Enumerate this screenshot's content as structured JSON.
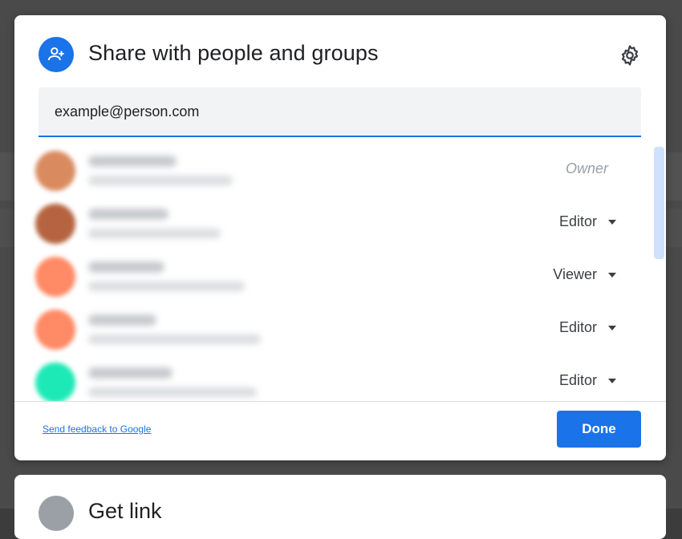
{
  "dialog": {
    "title": "Share with people and groups",
    "input": {
      "value": "example@person.com",
      "placeholder": ""
    },
    "people": [
      {
        "role": "Owner",
        "avatar_color": "#d98b5f",
        "owner": true
      },
      {
        "role": "Editor",
        "avatar_color": "#b5643f",
        "owner": false
      },
      {
        "role": "Viewer",
        "avatar_color": "#ff8a65",
        "owner": false
      },
      {
        "role": "Editor",
        "avatar_color": "#ff8a65",
        "owner": false
      },
      {
        "role": "Editor",
        "avatar_color": "#1de9b6",
        "owner": false
      }
    ],
    "feedback_link": "Send feedback to Google",
    "done_label": "Done"
  },
  "link_dialog": {
    "title": "Get link"
  },
  "colors": {
    "accent": "#1a73e8",
    "text": "#202124",
    "muted": "#9aa0a6"
  },
  "icons": {
    "header": "person-add-icon",
    "settings": "gear-icon",
    "role": "caret-down-icon"
  }
}
